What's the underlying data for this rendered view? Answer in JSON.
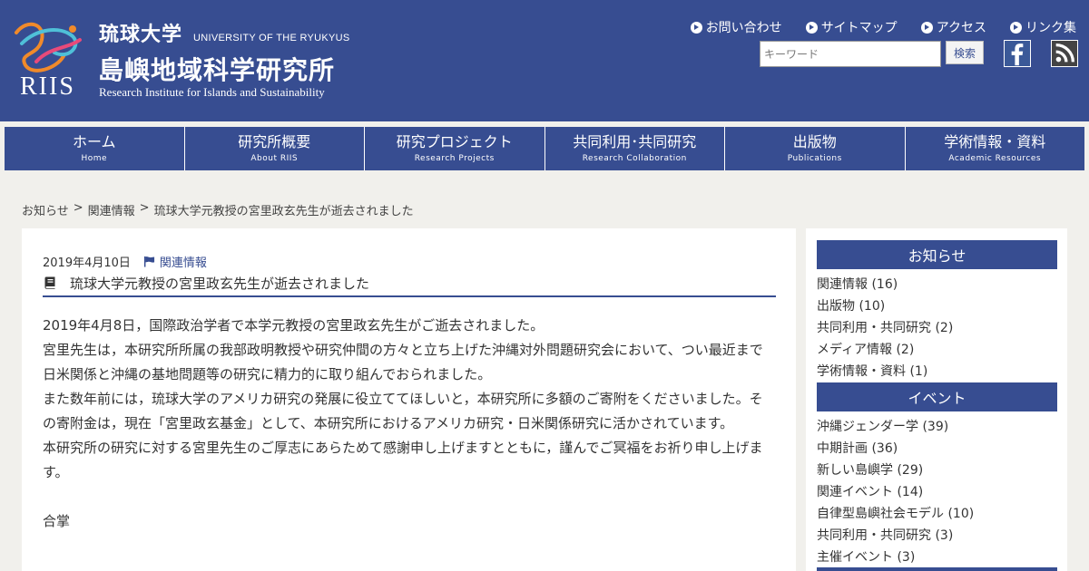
{
  "header": {
    "univ_jp": "琉球大学",
    "univ_en": "UNIVERSITY OF THE RYUKYUS",
    "inst_jp": "島嶼地域科学研究所",
    "inst_en": "Research Institute for Islands and Sustainability",
    "logo_text": "RIIS",
    "util_links": [
      "お問い合わせ",
      "サイトマップ",
      "アクセス",
      "リンク集"
    ],
    "search": {
      "placeholder": "キーワード",
      "button": "検索"
    },
    "social_icons": [
      "facebook-icon",
      "rss-icon"
    ]
  },
  "nav": [
    {
      "jp": "ホーム",
      "en": "Home"
    },
    {
      "jp": "研究所概要",
      "en": "About RIIS"
    },
    {
      "jp": "研究プロジェクト",
      "en": "Research Projects"
    },
    {
      "jp": "共同利用･共同研究",
      "en": "Research Collaboration"
    },
    {
      "jp": "出版物",
      "en": "Publications"
    },
    {
      "jp": "学術情報・資料",
      "en": "Academic Resources"
    }
  ],
  "breadcrumb": [
    "お知らせ",
    ">",
    "関連情報",
    ">",
    "琉球大学元教授の宮里政玄先生が逝去されました"
  ],
  "post": {
    "date": "2019年4月10日",
    "category": "関連情報",
    "title": "琉球大学元教授の宮里政玄先生が逝去されました",
    "paragraphs": [
      "2019年4月8日，国際政治学者で本学元教授の宮里政玄先生がご逝去されました。",
      "宮里先生は，本研究所所属の我部政明教授や研究仲間の方々と立ち上げた沖縄対外問題研究会において、つい最近まで日米関係と沖縄の基地問題等の研究に精力的に取り組んでおられました。",
      "また数年前には，琉球大学のアメリカ研究の発展に役立ててほしいと，本研究所に多額のご寄附をくださいました。その寄附金は，現在「宮里政玄基金」として、本研究所におけるアメリカ研究・日米関係研究に活かされています。",
      "本研究所の研究に対する宮里先生のご厚志にあらためて感謝申し上げますとともに，謹んでご冥福をお祈り申し上げます。"
    ],
    "closing": "合掌"
  },
  "sidebar": {
    "news_heading": "お知らせ",
    "news_items": [
      "関連情報 (16)",
      "出版物 (10)",
      "共同利用・共同研究 (2)",
      "メディア情報 (2)",
      "学術情報・資料 (1)"
    ],
    "events_heading": "イベント",
    "event_items": [
      "沖縄ジェンダー学 (39)",
      "中期計画 (36)",
      "新しい島嶼学 (29)",
      "関連イベント (14)",
      "自律型島嶼社会モデル (10)",
      "共同利用・共同研究 (3)",
      "主催イベント (3)"
    ]
  },
  "colors": {
    "primary": "#374d91",
    "background": "#f1f0ec",
    "facebook": "#3b5998"
  }
}
